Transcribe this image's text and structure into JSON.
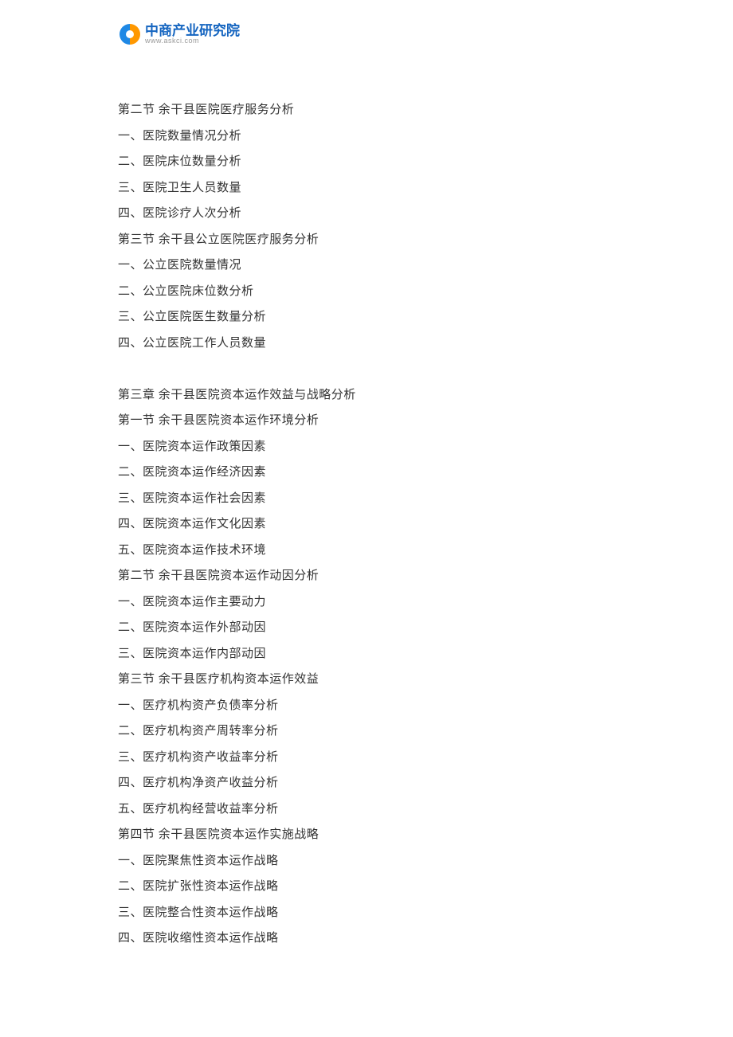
{
  "logo": {
    "text_cn": "中商产业研究院",
    "text_en": "www.askci.com"
  },
  "toc": {
    "block1": [
      "第二节 余干县医院医疗服务分析",
      "一、医院数量情况分析",
      "二、医院床位数量分析",
      "三、医院卫生人员数量",
      "四、医院诊疗人次分析",
      "第三节 余干县公立医院医疗服务分析",
      "一、公立医院数量情况",
      "二、公立医院床位数分析",
      "三、公立医院医生数量分析",
      "四、公立医院工作人员数量"
    ],
    "block2": [
      "第三章 余干县医院资本运作效益与战略分析",
      "第一节 余干县医院资本运作环境分析",
      "一、医院资本运作政策因素",
      "二、医院资本运作经济因素",
      "三、医院资本运作社会因素",
      "四、医院资本运作文化因素",
      "五、医院资本运作技术环境",
      "第二节 余干县医院资本运作动因分析",
      "一、医院资本运作主要动力",
      "二、医院资本运作外部动因",
      "三、医院资本运作内部动因",
      "第三节 余干县医疗机构资本运作效益",
      "一、医疗机构资产负债率分析",
      "二、医疗机构资产周转率分析",
      "三、医疗机构资产收益率分析",
      "四、医疗机构净资产收益分析",
      "五、医疗机构经营收益率分析",
      "第四节 余干县医院资本运作实施战略",
      "一、医院聚焦性资本运作战略",
      "二、医院扩张性资本运作战略",
      "三、医院整合性资本运作战略",
      "四、医院收缩性资本运作战略"
    ]
  }
}
